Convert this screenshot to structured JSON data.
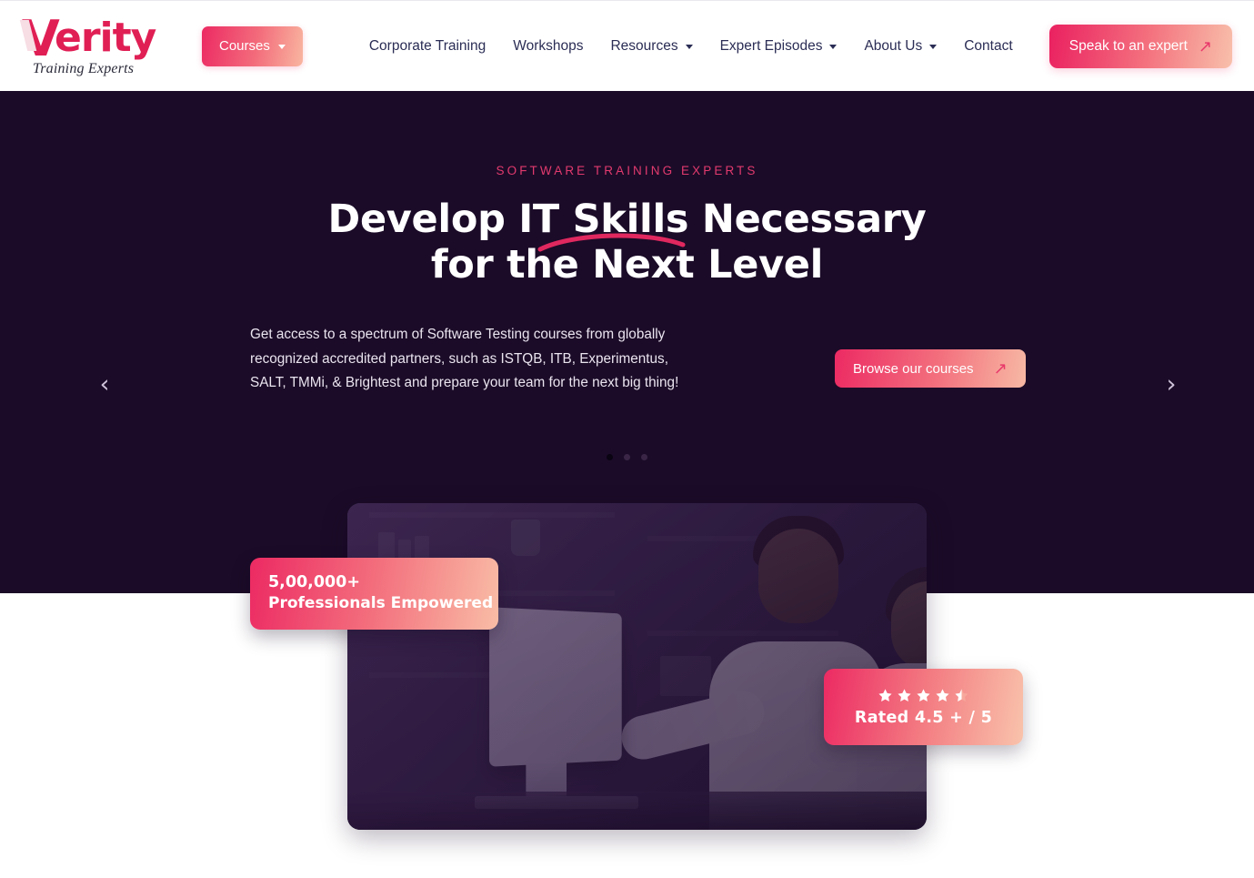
{
  "brand": {
    "name": "Verity",
    "name_initial": "V",
    "name_rest": "erity",
    "tagline": "Training Experts",
    "accent": "#e01f55"
  },
  "header": {
    "courses_button": {
      "label": "Courses",
      "icon": "chevron-down-icon"
    },
    "nav_items": [
      {
        "label": "Corporate Training",
        "has_dropdown": false
      },
      {
        "label": "Workshops",
        "has_dropdown": false
      },
      {
        "label": "Resources",
        "has_dropdown": true
      },
      {
        "label": "Expert Episodes",
        "has_dropdown": true
      },
      {
        "label": "About Us",
        "has_dropdown": true
      },
      {
        "label": "Contact",
        "has_dropdown": false
      }
    ],
    "cta": {
      "label": "Speak to an expert",
      "icon": "arrow-up-right-icon"
    },
    "background": "#ffffff",
    "text_color": "#2b2d55"
  },
  "hero": {
    "eyebrow": "SOFTWARE TRAINING EXPERTS",
    "headline_line1": "Develop IT Skills Necessary",
    "headline_line2": "for the Next Level",
    "paragraph": "Get access to a spectrum of Software Testing courses from globally recognized accredited partners, such as ISTQB, ITB, Experimentus, SALT, TMMi, & Brightest and prepare your team for the next big thing!",
    "cta": {
      "label": "Browse our courses",
      "icon": "arrow-up-right-icon"
    },
    "background": "#1b0b28",
    "accent": "#e23a6e",
    "prev_icon": "chevron-left-icon",
    "next_icon": "chevron-right-icon",
    "slides": [
      {
        "active": true
      },
      {
        "active": false
      },
      {
        "active": false
      }
    ]
  },
  "badges": {
    "stat": {
      "value": "5,00,000+",
      "label": "Professionals Empowered"
    },
    "rating": {
      "stars_total": 5,
      "stars_filled": 4,
      "stars_half": 1,
      "label": "Rated 4.5 + / 5"
    }
  },
  "media": {
    "alt": "Two colleagues working together at a desktop computer in an office"
  }
}
